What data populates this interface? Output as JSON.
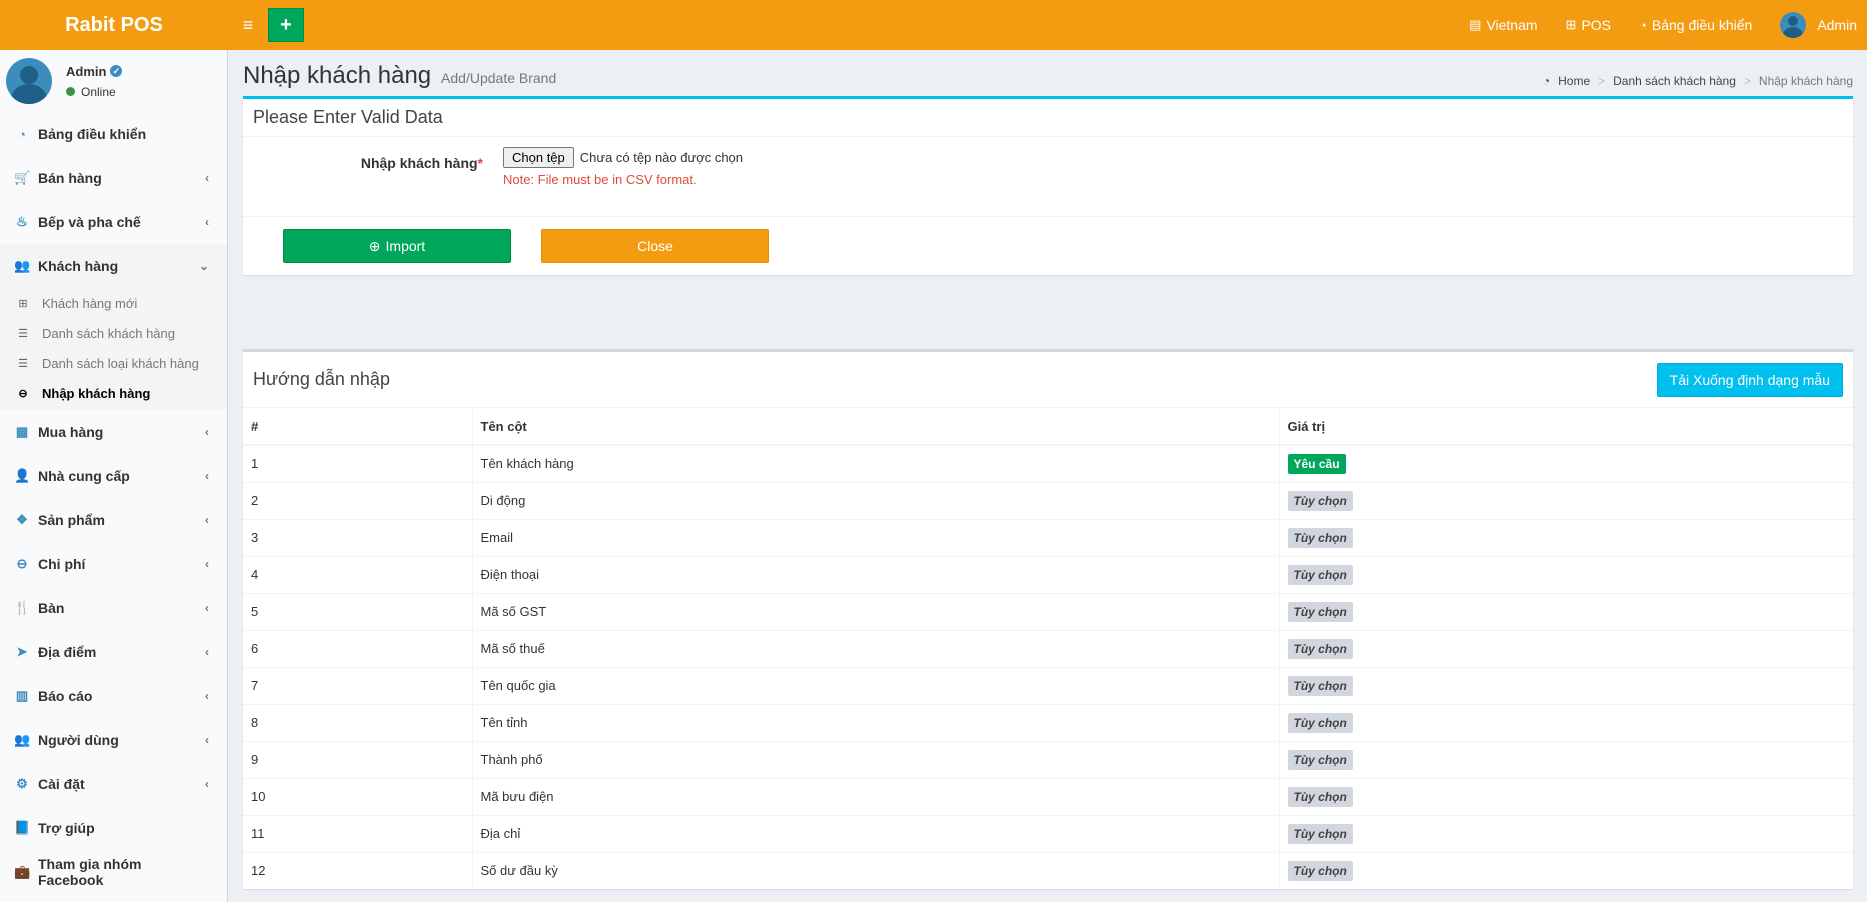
{
  "header": {
    "logo": "Rabit POS",
    "nav": {
      "language": "Vietnam",
      "pos": "POS",
      "dashboard": "Bảng điều khiển",
      "user": "Admin"
    }
  },
  "sidebar": {
    "user_name": "Admin",
    "user_status": "Online",
    "items": [
      {
        "label": "Bảng điều khiển"
      },
      {
        "label": "Bán hàng"
      },
      {
        "label": "Bếp và pha chế"
      },
      {
        "label": "Khách hàng"
      },
      {
        "label": "Mua hàng"
      },
      {
        "label": "Nhà cung cấp"
      },
      {
        "label": "Sản phẩm"
      },
      {
        "label": "Chi phí"
      },
      {
        "label": "Bàn"
      },
      {
        "label": "Địa điểm"
      },
      {
        "label": "Báo cáo"
      },
      {
        "label": "Người dùng"
      },
      {
        "label": "Cài đặt"
      },
      {
        "label": "Trợ giúp"
      },
      {
        "label": "Tham gia nhóm Facebook"
      }
    ],
    "sub_items": [
      {
        "label": "Khách hàng mới"
      },
      {
        "label": "Danh sách khách hàng"
      },
      {
        "label": "Danh sách loại khách hàng"
      },
      {
        "label": "Nhập khách hàng"
      }
    ]
  },
  "page": {
    "title": "Nhập khách hàng",
    "subtitle": "Add/Update Brand",
    "breadcrumb": [
      "Home",
      "Danh sách khách hàng",
      "Nhập khách hàng"
    ]
  },
  "form": {
    "heading": "Please Enter Valid Data",
    "field_label": "Nhập khách hàng",
    "required_mark": "*",
    "file_button": "Chọn tệp",
    "file_status": "Chưa có tệp nào được chọn",
    "note": "Note: File must be in CSV format.",
    "import_label": "Import",
    "close_label": "Close"
  },
  "guide": {
    "heading": "Hướng dẫn nhập",
    "download_label": "Tải Xuống định dạng mẫu",
    "columns": [
      "#",
      "Tên cột",
      "Giá trị"
    ],
    "rows": [
      {
        "n": "1",
        "name": "Tên khách hàng",
        "value": "Yêu cầu",
        "required": true
      },
      {
        "n": "2",
        "name": "Di động",
        "value": "Tùy chọn",
        "required": false
      },
      {
        "n": "3",
        "name": "Email",
        "value": "Tùy chọn",
        "required": false
      },
      {
        "n": "4",
        "name": "Điện thoại",
        "value": "Tùy chọn",
        "required": false
      },
      {
        "n": "5",
        "name": "Mã số GST",
        "value": "Tùy chọn",
        "required": false
      },
      {
        "n": "6",
        "name": "Mã số thuế",
        "value": "Tùy chọn",
        "required": false
      },
      {
        "n": "7",
        "name": "Tên quốc gia",
        "value": "Tùy chọn",
        "required": false
      },
      {
        "n": "8",
        "name": "Tên tỉnh",
        "value": "Tùy chọn",
        "required": false
      },
      {
        "n": "9",
        "name": "Thành phố",
        "value": "Tùy chọn",
        "required": false
      },
      {
        "n": "10",
        "name": "Mã bưu điện",
        "value": "Tùy chọn",
        "required": false
      },
      {
        "n": "11",
        "name": "Địa chỉ",
        "value": "Tùy chọn",
        "required": false
      },
      {
        "n": "12",
        "name": "Số dư đầu kỳ",
        "value": "Tùy chọn",
        "required": false
      }
    ]
  },
  "colors": {
    "header": "#f39c12",
    "accent": "#00c0ef",
    "success": "#00a65a"
  }
}
